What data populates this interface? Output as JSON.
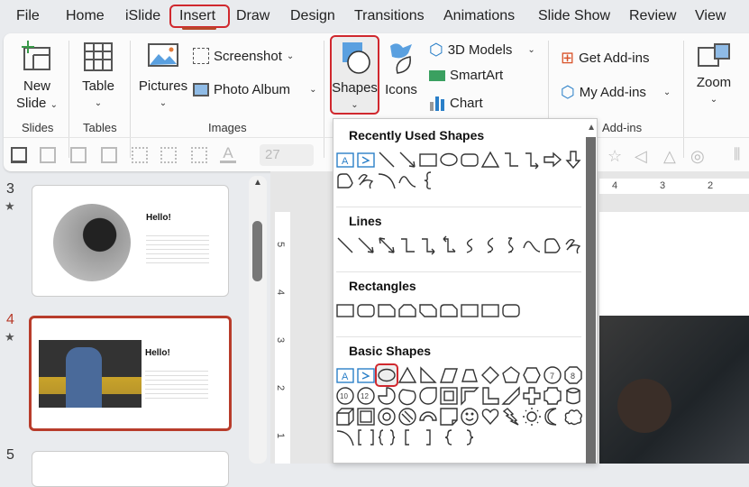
{
  "menu": {
    "tabs": [
      "File",
      "Home",
      "iSlide",
      "Insert",
      "Draw",
      "Design",
      "Transitions",
      "Animations",
      "Slide Show",
      "Review",
      "View"
    ],
    "active": "Insert"
  },
  "ribbon": {
    "slides": {
      "new_slide": "New",
      "new_slide2": "Slide",
      "group": "Slides"
    },
    "tables": {
      "table": "Table",
      "group": "Tables"
    },
    "images": {
      "pictures": "Pictures",
      "screenshot": "Screenshot",
      "photo_album": "Photo Album",
      "group": "Images"
    },
    "illustrations": {
      "shapes": "Shapes",
      "icons": "Icons",
      "models": "3D Models",
      "smartart": "SmartArt",
      "chart": "Chart"
    },
    "addins": {
      "get": "Get Add-ins",
      "my": "My Add-ins",
      "group": "Add-ins"
    },
    "links": {
      "zoom": "Zoom"
    }
  },
  "toolbar": {
    "font_size": "27"
  },
  "slides": [
    {
      "number": "3",
      "title": "Hello!"
    },
    {
      "number": "4",
      "title": "Hello!",
      "selected": true
    },
    {
      "number": "5"
    }
  ],
  "ruler": {
    "v": [
      "5",
      "4",
      "3",
      "2",
      "1"
    ],
    "h": [
      "4",
      "3",
      "2"
    ]
  },
  "shapes_panel": {
    "sections": [
      {
        "title": "Recently Used Shapes",
        "rows": [
          [
            "textbox",
            "vtextbox",
            "line",
            "arrow",
            "rect",
            "ellipse",
            "roundrect",
            "triangle",
            "elbow",
            "elbowarrow",
            "rightarrow",
            "downarrow"
          ],
          [
            "freeform",
            "scribble",
            "arc",
            "curve",
            "brace"
          ]
        ]
      },
      {
        "title": "Lines",
        "rows": [
          [
            "line",
            "arrow",
            "dblarrow",
            "elbow",
            "elbowarrow",
            "elbowdbl",
            "curved",
            "curvedarrow",
            "curveddbl",
            "curve",
            "freeform",
            "scribble"
          ]
        ]
      },
      {
        "title": "Rectangles",
        "rows": [
          [
            "rect",
            "roundrect",
            "snip1",
            "snip2",
            "snipdiag",
            "sniproundcorner",
            "rect",
            "rect",
            "roundrect"
          ]
        ]
      },
      {
        "title": "Basic Shapes",
        "rows": [
          [
            "textbox",
            "vtextbox",
            "ellipse",
            "triangle",
            "rtriangle",
            "parallelogram",
            "trapezoid",
            "diamond",
            "pentagon",
            "hexagon",
            "heptagon",
            "octagon"
          ],
          [
            "decagon",
            "dodecagon",
            "pie",
            "chord",
            "teardrop",
            "frame",
            "halfframe",
            "lshape",
            "diagstripe",
            "cross",
            "plaque",
            "can"
          ],
          [
            "cube",
            "bevel",
            "donut",
            "nosymbol",
            "blockarc",
            "foldedcorner",
            "smiley",
            "heart",
            "lightning",
            "sun",
            "moon",
            "cloud"
          ],
          [
            "arc",
            "brackets",
            "braces",
            "lbracket",
            "rbracket",
            "lbrace",
            "rbrace"
          ]
        ]
      }
    ],
    "highlighted": "ellipse",
    "accent": "#d0282e"
  },
  "colors": {
    "accent": "#b83c2b",
    "highlight": "#d0282e",
    "icon_blue": "#4a90d9"
  }
}
